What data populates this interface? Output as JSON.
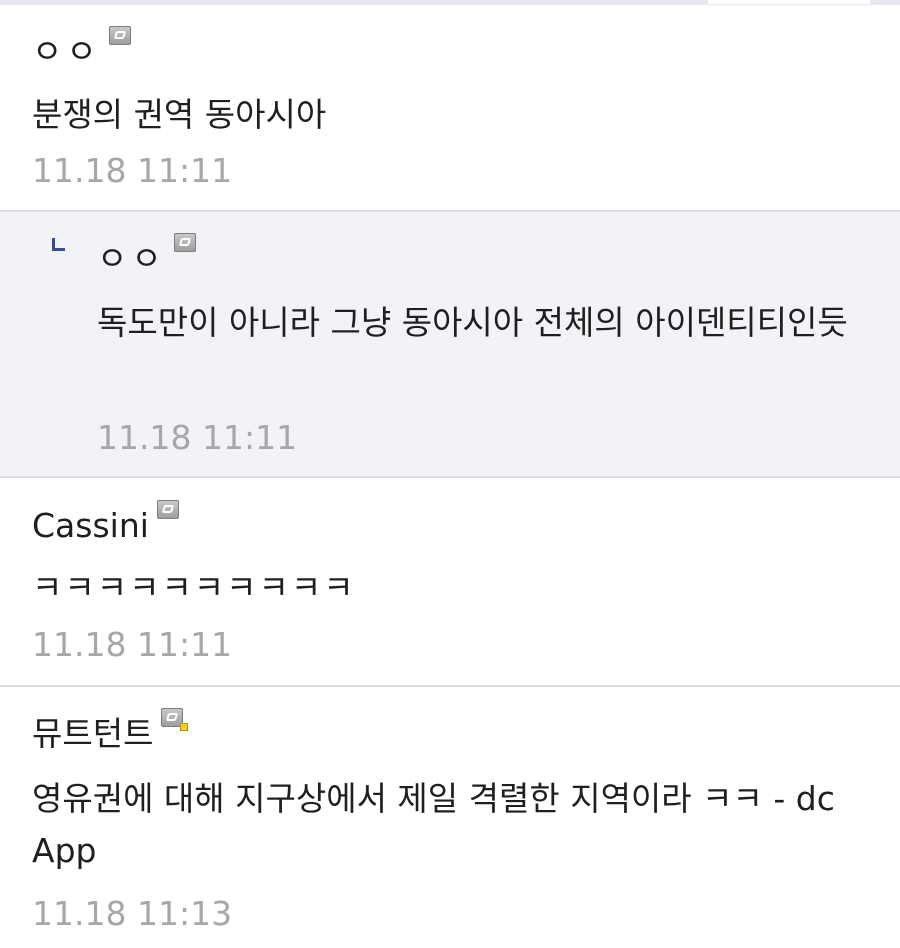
{
  "comments": [
    {
      "nickname": "ㅇㅇ",
      "text": "분쟁의 권역 동아시아",
      "time": "11.18 11:11",
      "is_reply": false
    },
    {
      "nickname": "ㅇㅇ",
      "text": "독도만이 아니라 그냥 동아시아 전체의 아이덴티티인듯",
      "time": "11.18 11:11",
      "is_reply": true
    },
    {
      "nickname": "Cassini",
      "text": "ㅋㅋㅋㅋㅋㅋㅋㅋㅋㅋ",
      "time": "11.18 11:11",
      "is_reply": false
    },
    {
      "nickname": "뮤트턴트",
      "text": "영유권에 대해 지구상에서 제일 격렬한 지역이라 ㅋㅋ - dc App",
      "time": "11.18 11:13",
      "is_reply": false
    }
  ],
  "colors": {
    "reply_background": "#f2f3f7",
    "divider": "#dcdde3",
    "timestamp": "#a6a6ab",
    "reply_marker": "#3e4a8c"
  }
}
